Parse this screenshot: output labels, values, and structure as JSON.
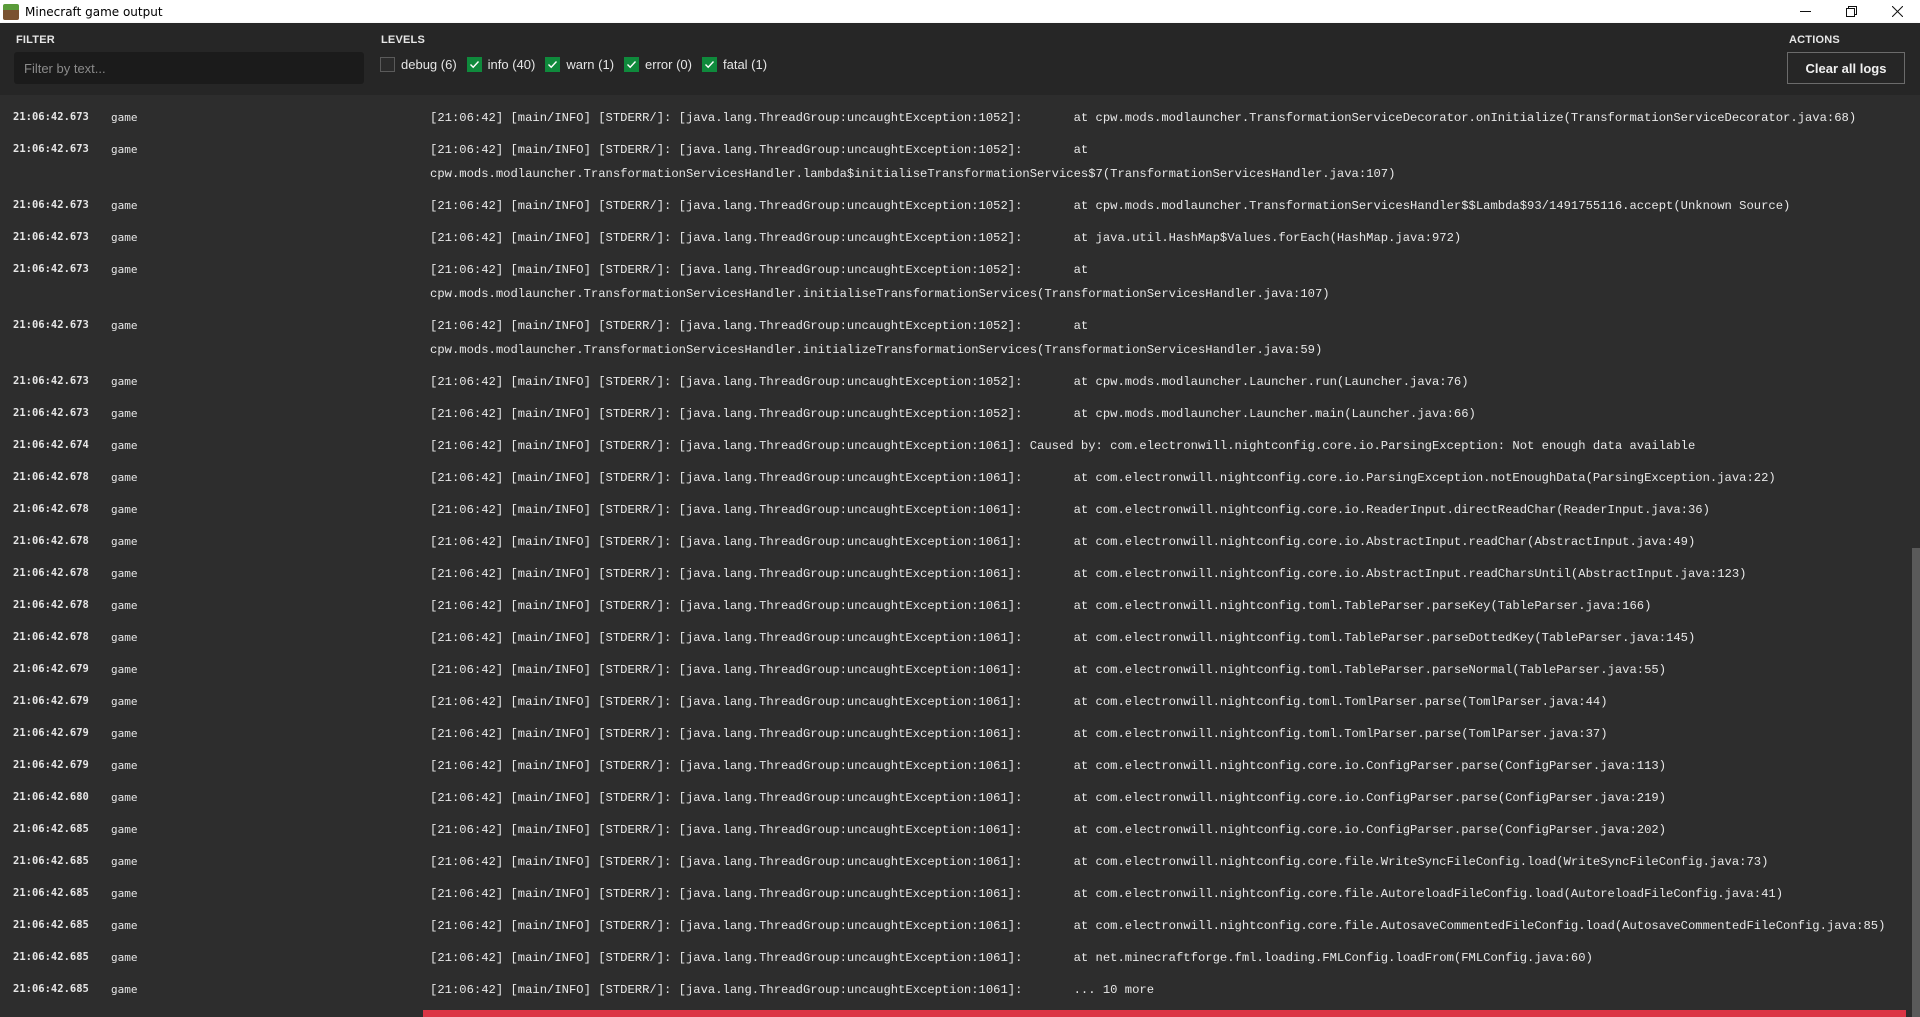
{
  "window": {
    "title": "Minecraft game output",
    "controls": [
      "minimize",
      "restore",
      "close"
    ]
  },
  "toolbar": {
    "filter_label": "FILTER",
    "filter_placeholder": "Filter by text...",
    "filter_value": "",
    "levels_label": "LEVELS",
    "levels": [
      {
        "label": "debug (6)",
        "checked": false
      },
      {
        "label": "info (40)",
        "checked": true
      },
      {
        "label": "warn (1)",
        "checked": true
      },
      {
        "label": "error (0)",
        "checked": true
      },
      {
        "label": "fatal (1)",
        "checked": true
      }
    ],
    "actions_label": "ACTIONS",
    "clear_label": "Clear all logs"
  },
  "colors": {
    "checkbox_checked": "#0f8a3c",
    "fatal_row": "#dc3545",
    "background": "#2d2d2d",
    "toolbar": "#262626"
  },
  "logs": [
    {
      "time": "21:06:42.673",
      "source": "game",
      "message": "[21:06:42] [main/INFO] [STDERR/]: [java.lang.ThreadGroup:uncaughtException:1052]:       at cpw.mods.modlauncher.TransformationServiceDecorator.onInitialize(TransformationServiceDecorator.java:68)",
      "lines": 1
    },
    {
      "time": "21:06:42.673",
      "source": "game",
      "message": "[21:06:42] [main/INFO] [STDERR/]: [java.lang.ThreadGroup:uncaughtException:1052]:       at\ncpw.mods.modlauncher.TransformationServicesHandler.lambda$initialiseTransformationServices$7(TransformationServicesHandler.java:107)",
      "lines": 2
    },
    {
      "time": "21:06:42.673",
      "source": "game",
      "message": "[21:06:42] [main/INFO] [STDERR/]: [java.lang.ThreadGroup:uncaughtException:1052]:       at cpw.mods.modlauncher.TransformationServicesHandler$$Lambda$93/1491755116.accept(Unknown Source)",
      "lines": 1
    },
    {
      "time": "21:06:42.673",
      "source": "game",
      "message": "[21:06:42] [main/INFO] [STDERR/]: [java.lang.ThreadGroup:uncaughtException:1052]:       at java.util.HashMap$Values.forEach(HashMap.java:972)",
      "lines": 1
    },
    {
      "time": "21:06:42.673",
      "source": "game",
      "message": "[21:06:42] [main/INFO] [STDERR/]: [java.lang.ThreadGroup:uncaughtException:1052]:       at\ncpw.mods.modlauncher.TransformationServicesHandler.initialiseTransformationServices(TransformationServicesHandler.java:107)",
      "lines": 2
    },
    {
      "time": "21:06:42.673",
      "source": "game",
      "message": "[21:06:42] [main/INFO] [STDERR/]: [java.lang.ThreadGroup:uncaughtException:1052]:       at\ncpw.mods.modlauncher.TransformationServicesHandler.initializeTransformationServices(TransformationServicesHandler.java:59)",
      "lines": 2
    },
    {
      "time": "21:06:42.673",
      "source": "game",
      "message": "[21:06:42] [main/INFO] [STDERR/]: [java.lang.ThreadGroup:uncaughtException:1052]:       at cpw.mods.modlauncher.Launcher.run(Launcher.java:76)",
      "lines": 1
    },
    {
      "time": "21:06:42.673",
      "source": "game",
      "message": "[21:06:42] [main/INFO] [STDERR/]: [java.lang.ThreadGroup:uncaughtException:1052]:       at cpw.mods.modlauncher.Launcher.main(Launcher.java:66)",
      "lines": 1
    },
    {
      "time": "21:06:42.674",
      "source": "game",
      "message": "[21:06:42] [main/INFO] [STDERR/]: [java.lang.ThreadGroup:uncaughtException:1061]: Caused by: com.electronwill.nightconfig.core.io.ParsingException: Not enough data available",
      "lines": 1
    },
    {
      "time": "21:06:42.678",
      "source": "game",
      "message": "[21:06:42] [main/INFO] [STDERR/]: [java.lang.ThreadGroup:uncaughtException:1061]:       at com.electronwill.nightconfig.core.io.ParsingException.notEnoughData(ParsingException.java:22)",
      "lines": 1
    },
    {
      "time": "21:06:42.678",
      "source": "game",
      "message": "[21:06:42] [main/INFO] [STDERR/]: [java.lang.ThreadGroup:uncaughtException:1061]:       at com.electronwill.nightconfig.core.io.ReaderInput.directReadChar(ReaderInput.java:36)",
      "lines": 1
    },
    {
      "time": "21:06:42.678",
      "source": "game",
      "message": "[21:06:42] [main/INFO] [STDERR/]: [java.lang.ThreadGroup:uncaughtException:1061]:       at com.electronwill.nightconfig.core.io.AbstractInput.readChar(AbstractInput.java:49)",
      "lines": 1
    },
    {
      "time": "21:06:42.678",
      "source": "game",
      "message": "[21:06:42] [main/INFO] [STDERR/]: [java.lang.ThreadGroup:uncaughtException:1061]:       at com.electronwill.nightconfig.core.io.AbstractInput.readCharsUntil(AbstractInput.java:123)",
      "lines": 1
    },
    {
      "time": "21:06:42.678",
      "source": "game",
      "message": "[21:06:42] [main/INFO] [STDERR/]: [java.lang.ThreadGroup:uncaughtException:1061]:       at com.electronwill.nightconfig.toml.TableParser.parseKey(TableParser.java:166)",
      "lines": 1
    },
    {
      "time": "21:06:42.678",
      "source": "game",
      "message": "[21:06:42] [main/INFO] [STDERR/]: [java.lang.ThreadGroup:uncaughtException:1061]:       at com.electronwill.nightconfig.toml.TableParser.parseDottedKey(TableParser.java:145)",
      "lines": 1
    },
    {
      "time": "21:06:42.679",
      "source": "game",
      "message": "[21:06:42] [main/INFO] [STDERR/]: [java.lang.ThreadGroup:uncaughtException:1061]:       at com.electronwill.nightconfig.toml.TableParser.parseNormal(TableParser.java:55)",
      "lines": 1
    },
    {
      "time": "21:06:42.679",
      "source": "game",
      "message": "[21:06:42] [main/INFO] [STDERR/]: [java.lang.ThreadGroup:uncaughtException:1061]:       at com.electronwill.nightconfig.toml.TomlParser.parse(TomlParser.java:44)",
      "lines": 1
    },
    {
      "time": "21:06:42.679",
      "source": "game",
      "message": "[21:06:42] [main/INFO] [STDERR/]: [java.lang.ThreadGroup:uncaughtException:1061]:       at com.electronwill.nightconfig.toml.TomlParser.parse(TomlParser.java:37)",
      "lines": 1
    },
    {
      "time": "21:06:42.679",
      "source": "game",
      "message": "[21:06:42] [main/INFO] [STDERR/]: [java.lang.ThreadGroup:uncaughtException:1061]:       at com.electronwill.nightconfig.core.io.ConfigParser.parse(ConfigParser.java:113)",
      "lines": 1
    },
    {
      "time": "21:06:42.680",
      "source": "game",
      "message": "[21:06:42] [main/INFO] [STDERR/]: [java.lang.ThreadGroup:uncaughtException:1061]:       at com.electronwill.nightconfig.core.io.ConfigParser.parse(ConfigParser.java:219)",
      "lines": 1
    },
    {
      "time": "21:06:42.685",
      "source": "game",
      "message": "[21:06:42] [main/INFO] [STDERR/]: [java.lang.ThreadGroup:uncaughtException:1061]:       at com.electronwill.nightconfig.core.io.ConfigParser.parse(ConfigParser.java:202)",
      "lines": 1
    },
    {
      "time": "21:06:42.685",
      "source": "game",
      "message": "[21:06:42] [main/INFO] [STDERR/]: [java.lang.ThreadGroup:uncaughtException:1061]:       at com.electronwill.nightconfig.core.file.WriteSyncFileConfig.load(WriteSyncFileConfig.java:73)",
      "lines": 1
    },
    {
      "time": "21:06:42.685",
      "source": "game",
      "message": "[21:06:42] [main/INFO] [STDERR/]: [java.lang.ThreadGroup:uncaughtException:1061]:       at com.electronwill.nightconfig.core.file.AutoreloadFileConfig.load(AutoreloadFileConfig.java:41)",
      "lines": 1
    },
    {
      "time": "21:06:42.685",
      "source": "game",
      "message": "[21:06:42] [main/INFO] [STDERR/]: [java.lang.ThreadGroup:uncaughtException:1061]:       at com.electronwill.nightconfig.core.file.AutosaveCommentedFileConfig.load(AutosaveCommentedFileConfig.java:85)",
      "lines": 1
    },
    {
      "time": "21:06:42.685",
      "source": "game",
      "message": "[21:06:42] [main/INFO] [STDERR/]: [java.lang.ThreadGroup:uncaughtException:1061]:       at net.minecraftforge.fml.loading.FMLConfig.loadFrom(FMLConfig.java:60)",
      "lines": 1
    },
    {
      "time": "21:06:42.685",
      "source": "game",
      "message": "[21:06:42] [main/INFO] [STDERR/]: [java.lang.ThreadGroup:uncaughtException:1061]:       ... 10 more",
      "lines": 1
    }
  ]
}
